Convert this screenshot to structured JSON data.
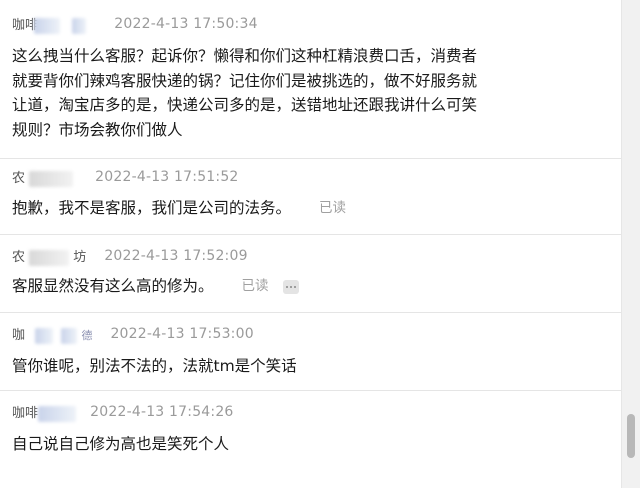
{
  "messages": [
    {
      "sender": "咖啡",
      "time": "2022-4-13 17:50:34",
      "lines": [
        "这么拽当什么客服？起诉你？懒得和你们这种杠精浪费口舌，消费者",
        "就要背你们辣鸡客服快递的锅？记住你们是被挑选的，做不好服务就",
        "让道，淘宝店多的是，快递公司多的是，送错地址还跟我讲什么可笑",
        "规则？市场会教你们做人"
      ]
    },
    {
      "sender": "农",
      "time": "2022-4-13 17:51:52",
      "lines": [
        "抱歉，我不是客服，我们是公司的法务。"
      ],
      "status": "已读"
    },
    {
      "sender": "农",
      "sender_tail": "坊",
      "time": "2022-4-13 17:52:09",
      "lines": [
        "客服显然没有这么高的修为。"
      ],
      "status": "已读"
    },
    {
      "sender": "咖",
      "sender_tail": "德",
      "time": "2022-4-13 17:53:00",
      "lines": [
        "管你谁呢，别法不法的，法就tm是个笑话"
      ]
    },
    {
      "sender": "咖啡",
      "time": "2022-4-13 17:54:26",
      "lines": [
        "自己说自己修为高也是笑死个人"
      ]
    }
  ]
}
